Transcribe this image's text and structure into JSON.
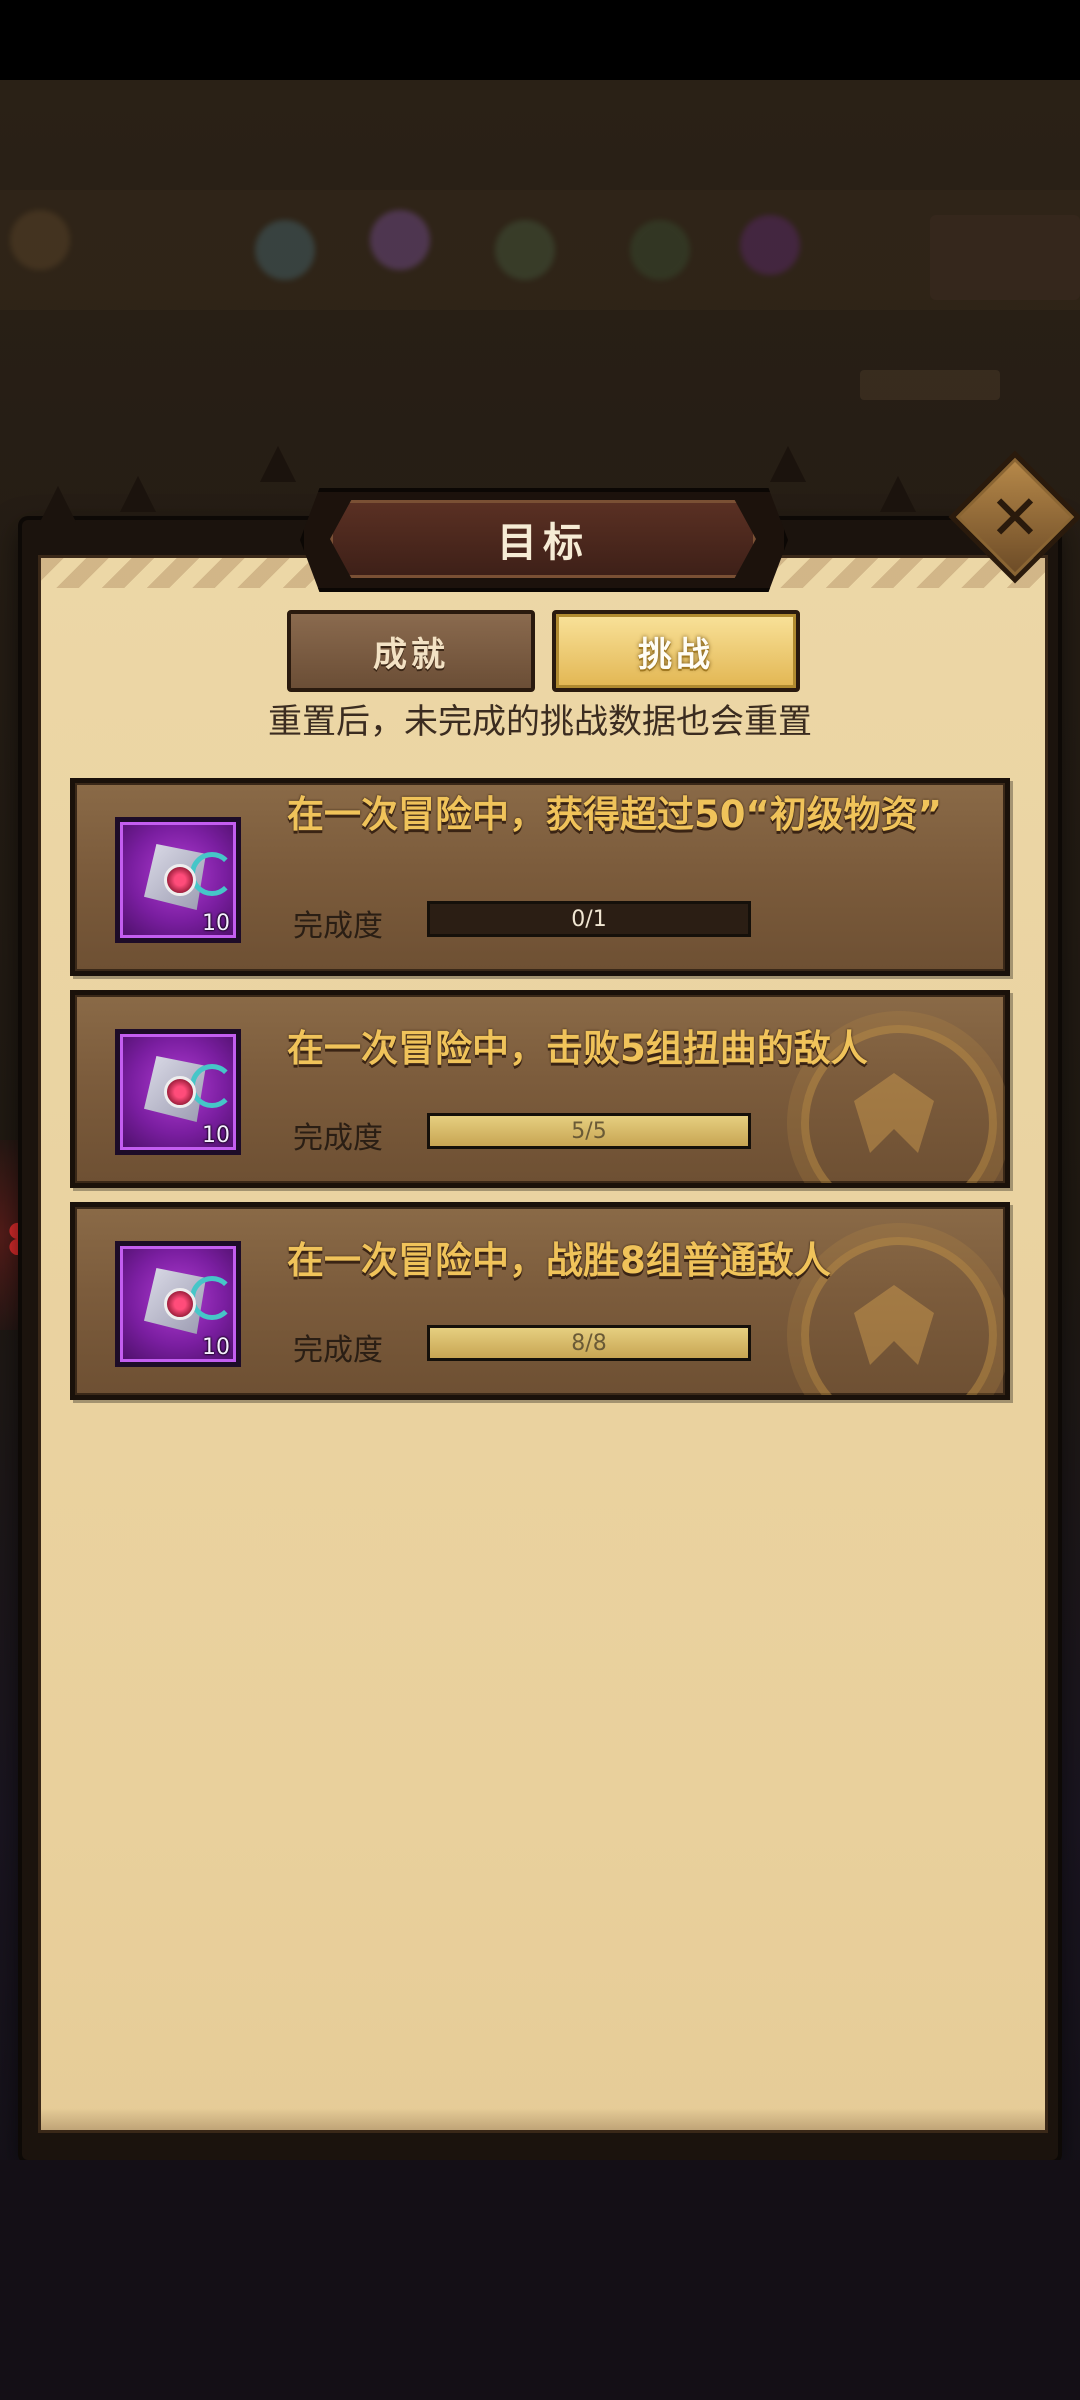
{
  "window": {
    "title": "目标"
  },
  "tabs": [
    {
      "label": "成就",
      "selected": false
    },
    {
      "label": "挑战",
      "selected": true
    }
  ],
  "notice": "重置后，未完成的挑战数据也会重置",
  "progress_label": "完成度",
  "tasks": [
    {
      "title": "在一次冒险中，获得超过50“初级物资”",
      "reward": {
        "icon": "scroll-bundle-icon",
        "quantity": "10"
      },
      "progress": {
        "current": 0,
        "total": 1,
        "text": "0/1",
        "fraction": 0
      },
      "completed": false
    },
    {
      "title": "在一次冒险中，击败5组扭曲的敌人",
      "reward": {
        "icon": "scroll-bundle-icon",
        "quantity": "10"
      },
      "progress": {
        "current": 5,
        "total": 5,
        "text": "5/5",
        "fraction": 1
      },
      "completed": true
    },
    {
      "title": "在一次冒险中，战胜8组普通敌人",
      "reward": {
        "icon": "scroll-bundle-icon",
        "quantity": "10"
      },
      "progress": {
        "current": 8,
        "total": 8,
        "text": "8/8",
        "fraction": 1
      },
      "completed": true
    }
  ],
  "icons": {
    "close": "close-icon",
    "completed_stamp": "emblem-stamp-icon"
  },
  "colors": {
    "title_gold": "#f0c35a",
    "parchment": "#ead3a1",
    "reward_purple": "#7a1ea0",
    "bar_fill": "#d8bb68"
  }
}
